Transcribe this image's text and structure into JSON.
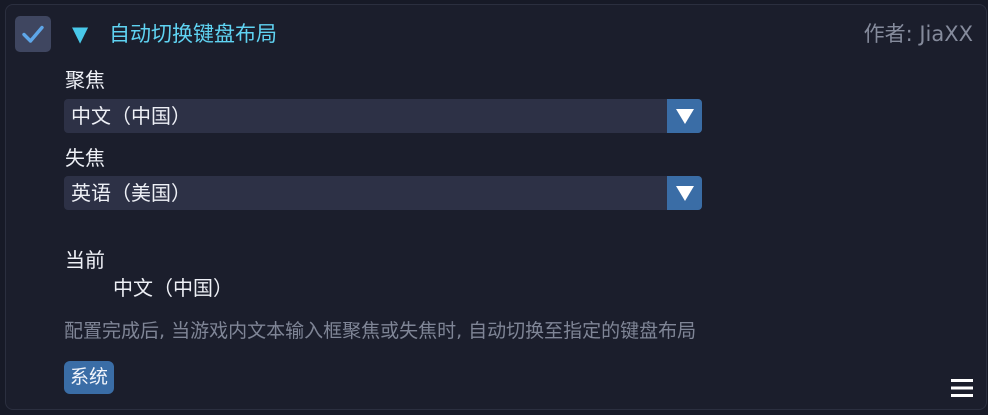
{
  "header": {
    "enabled": true,
    "title": "自动切换键盘布局",
    "author": "作者: JiaXX"
  },
  "focus": {
    "label": "聚焦",
    "selected": "中文（中国）"
  },
  "blur": {
    "label": "失焦",
    "selected": "英语（美国）"
  },
  "current": {
    "label": "当前",
    "value": "中文（中国）"
  },
  "description": "配置完成后, 当游戏内文本输入框聚焦或失焦时, 自动切换至指定的键盘布局",
  "tag": "系统",
  "colors": {
    "background": "#1b1e2c",
    "accent_cyan": "#5fd3f2",
    "accent_blue": "#3a6da6",
    "select_bg": "#2d3146",
    "muted_text": "#7f8596"
  },
  "icons": {
    "checkbox": "check-icon",
    "collapse": "triangle-down-icon",
    "dropdown": "triangle-down-icon",
    "menu": "hamburger-menu-icon"
  }
}
